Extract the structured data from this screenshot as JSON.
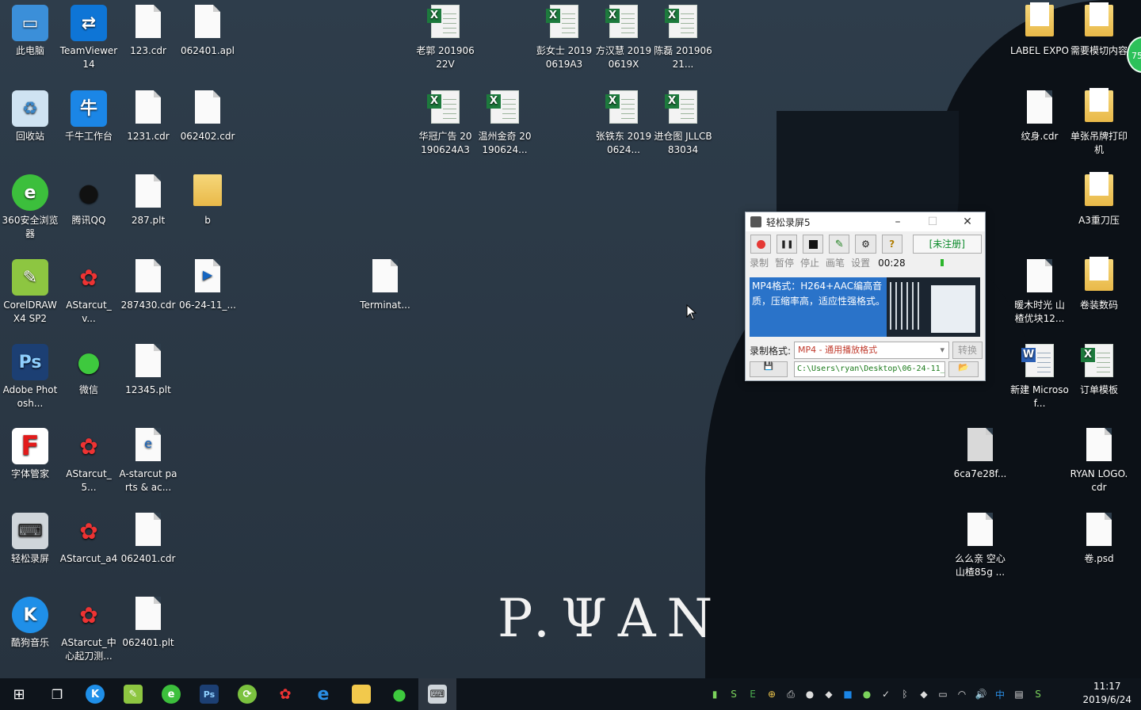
{
  "desktop_icons": {
    "this_pc": "此电脑",
    "teamviewer": "TeamViewer 14",
    "f123cdr": "123.cdr",
    "f062401apl": "062401.apl",
    "excel_laoguo": "老郭 20190622V",
    "excel_pengnvshi": "彭女士 20190619A3",
    "excel_fanghanhui": "方汉慧 20190619X",
    "excel_chenlei": "陈磊 20190621...",
    "label_expo": "LABEL EXPO",
    "need_cut": "需要模切内容",
    "recycle_bin": "回收站",
    "qianniu": "千牛工作台",
    "f1231cdr": "1231.cdr",
    "f062402cdr": "062402.cdr",
    "excel_huaguan": "华冠广告 20190624A3",
    "excel_wenzhou": "温州金奇 20190624...",
    "excel_zhangtiedong": "张铁东 20190624...",
    "excel_jincangtu": "进仓图 JLLCB83034",
    "wenshen_cdr": "纹身.cdr",
    "danzhang": "单张吊牌打印机",
    "browser360": "360安全浏览器",
    "tencentqq": "腾讯QQ",
    "f287plt": "287.plt",
    "folder_b": "b",
    "a3_knife": "A3重刀压",
    "coreldraw": "CorelDRAW X4 SP2",
    "astarcut_v": "AStarcut_v...",
    "f287430cdr": "287430.cdr",
    "f062411": "06-24-11_...",
    "terminat": "Terminat...",
    "nuanmu": "暖木时光 山楂优块12...",
    "juanzhuang": "卷装数码",
    "photoshop": "Adobe Photosh...",
    "wechat": "微信",
    "f12345plt": "12345.plt",
    "new_word": "新建 Microsof...",
    "order_template": "订单模板",
    "font_manager": "字体管家",
    "astarcut_5": "AStarcut_5...",
    "pdf_astarcut": "A-starcut parts & ac...",
    "f6ca7e28f": "6ca7e28f...",
    "ryan_logo_cdr": "RYAN LOGO.cdr",
    "qsrecorder": "轻松录屏",
    "astarcut_a4": "AStarcut_a4",
    "f062401cdr": "062401.cdr",
    "memeqin": "么么亲 空心山楂85g ...",
    "juan_psd": "卷.psd",
    "kugou": "酷狗音乐",
    "astarcut_zh": "AStarcut_中心起刀测...",
    "f062401plt": "062401.plt"
  },
  "wallpaper": {
    "logo_text": "P.ΨAN"
  },
  "recorder": {
    "title": "轻松录屏5",
    "register": "[未注册]",
    "labels": {
      "record": "录制",
      "pause": "暂停",
      "stop": "停止",
      "draw": "画笔",
      "settings": "设置"
    },
    "timer": "00:28",
    "info_text": "MP4格式：H264+AAC编高音质，压缩率高，适应性强格式。",
    "format_label": "录制格式:",
    "format_value": "MP4 - 通用播放格式",
    "convert_label": "转换",
    "path": "C:\\Users\\ryan\\Desktop\\06-24-11_"
  },
  "clock": {
    "time": "11:17",
    "date": "2019/6/24"
  },
  "badge": "75"
}
